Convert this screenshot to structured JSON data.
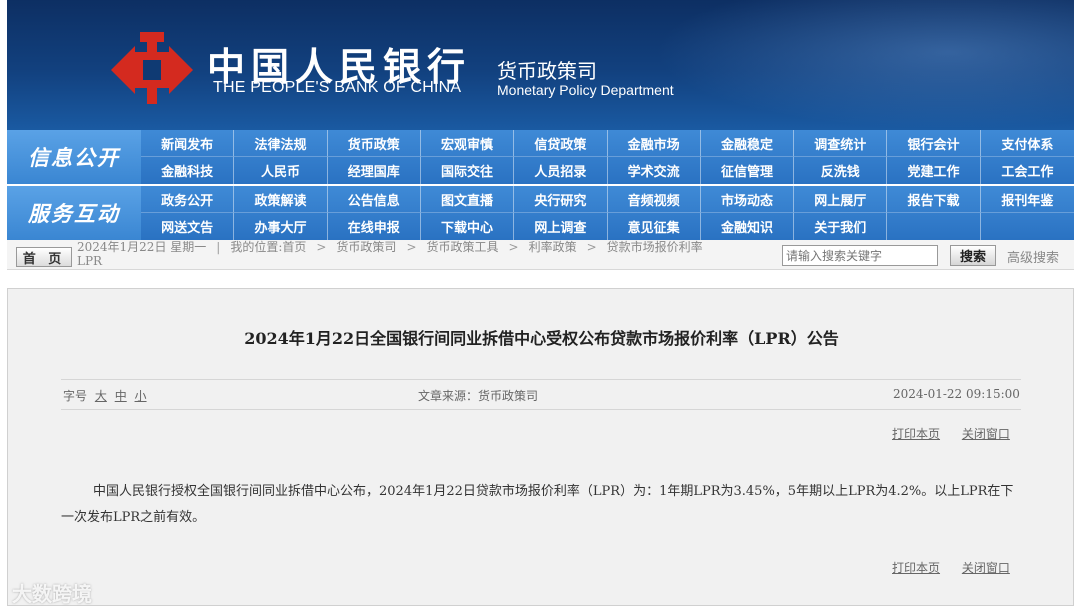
{
  "banner": {
    "bank_name_cn": "中国人民银行",
    "bank_name_en": "THE PEOPLE'S BANK OF CHINA",
    "dept_cn": "货币政策司",
    "dept_en": "Monetary Policy Department"
  },
  "nav": {
    "info": {
      "heading": "信息公开",
      "items": [
        "新闻发布",
        "法律法规",
        "货币政策",
        "宏观审慎",
        "信贷政策",
        "金融市场",
        "金融稳定",
        "调查统计",
        "银行会计",
        "支付体系",
        "金融科技",
        "人民币",
        "经理国库",
        "国际交往",
        "人员招录",
        "学术交流",
        "征信管理",
        "反洗钱",
        "党建工作",
        "工会工作"
      ]
    },
    "service": {
      "heading": "服务互动",
      "items": [
        "政务公开",
        "政策解读",
        "公告信息",
        "图文直播",
        "央行研究",
        "音频视频",
        "市场动态",
        "网上展厅",
        "报告下载",
        "报刊年鉴",
        "网送文告",
        "办事大厅",
        "在线申报",
        "下载中心",
        "网上调查",
        "意见征集",
        "金融知识",
        "关于我们",
        "",
        ""
      ]
    }
  },
  "breadcrumb": {
    "home_label": "首 页",
    "date": "2024年1月22日 星期一",
    "location_label": "我的位置:首页",
    "path": [
      "货币政策司",
      "货币政策工具",
      "利率政策",
      "贷款市场报价利率"
    ],
    "path_tail": "LPR",
    "search_placeholder": "请输入搜索关键字",
    "search_button": "搜索",
    "advanced_search": "高级搜索"
  },
  "article": {
    "title": "2024年1月22日全国银行间同业拆借中心受权公布贷款市场报价利率（LPR）公告",
    "font_label": "字号",
    "font_sizes": [
      "大",
      "中",
      "小"
    ],
    "source": "文章来源：货币政策司",
    "datetime": "2024-01-22 09:15:00",
    "print_label": "打印本页",
    "close_label": "关闭窗口",
    "body": "中国人民银行授权全国银行间同业拆借中心公布，2024年1月22日贷款市场报价利率（LPR）为：1年期LPR为3.45%，5年期以上LPR为4.2%。以上LPR在下一次发布LPR之前有效。"
  },
  "watermark": "大数跨境",
  "colors": {
    "banner_dark": "#0d2f63",
    "nav_blue": "#2a72c2",
    "emblem_red": "#d42a1f"
  }
}
